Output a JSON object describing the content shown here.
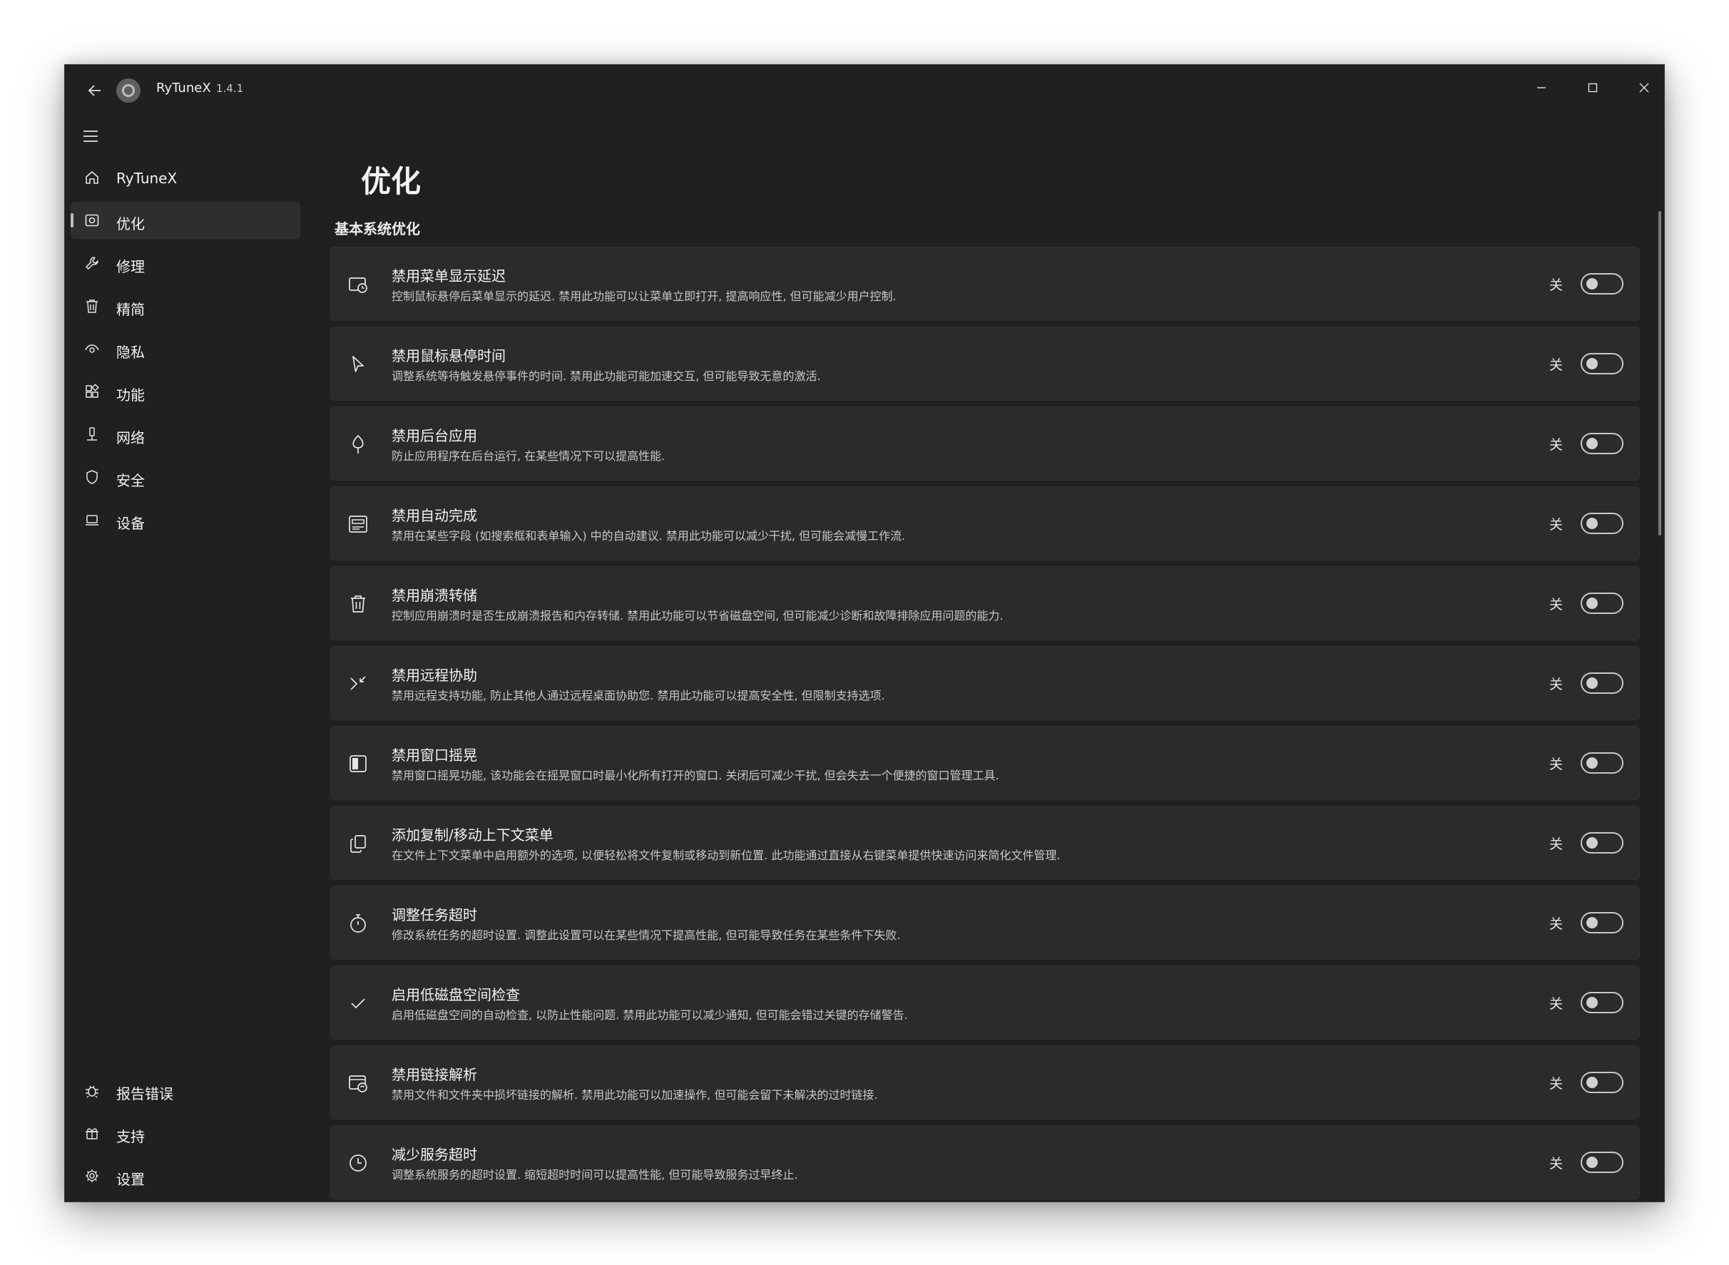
{
  "app": {
    "title": "RyTuneX",
    "version": "1.4.1"
  },
  "sidebar": {
    "items": [
      {
        "label": "RyTuneX",
        "icon": "home-icon"
      },
      {
        "label": "优化",
        "icon": "optimize-icon",
        "selected": true
      },
      {
        "label": "修理",
        "icon": "wrench-icon"
      },
      {
        "label": "精简",
        "icon": "trash-icon"
      },
      {
        "label": "隐私",
        "icon": "eye-icon"
      },
      {
        "label": "功能",
        "icon": "apps-icon"
      },
      {
        "label": "网络",
        "icon": "network-icon"
      },
      {
        "label": "安全",
        "icon": "shield-icon"
      },
      {
        "label": "设备",
        "icon": "laptop-icon"
      }
    ],
    "footer": [
      {
        "label": "报告错误",
        "icon": "bug-icon"
      },
      {
        "label": "支持",
        "icon": "support-icon"
      },
      {
        "label": "设置",
        "icon": "gear-icon"
      }
    ]
  },
  "page": {
    "title": "优化",
    "section": "基本系统优化",
    "toggle_off_label": "关"
  },
  "settings": [
    {
      "title": "禁用菜单显示延迟",
      "desc": "控制鼠标悬停后菜单显示的延迟. 禁用此功能可以让菜单立即打开, 提高响应性, 但可能减少用户控制.",
      "state": "off",
      "icon": "menu-delay-icon"
    },
    {
      "title": "禁用鼠标悬停时间",
      "desc": "调整系统等待触发悬停事件的时间. 禁用此功能可能加速交互, 但可能导致无意的激活.",
      "state": "off",
      "icon": "cursor-icon"
    },
    {
      "title": "禁用后台应用",
      "desc": "防止应用程序在后台运行, 在某些情况下可以提高性能.",
      "state": "off",
      "icon": "leaf-icon"
    },
    {
      "title": "禁用自动完成",
      "desc": "禁用在某些字段 (如搜索框和表单输入) 中的自动建议. 禁用此功能可以减少干扰, 但可能会减慢工作流.",
      "state": "off",
      "icon": "form-icon"
    },
    {
      "title": "禁用崩溃转储",
      "desc": "控制应用崩溃时是否生成崩溃报告和内存转储. 禁用此功能可以节省磁盘空间, 但可能减少诊断和故障排除应用问题的能力.",
      "state": "off",
      "icon": "delete-icon"
    },
    {
      "title": "禁用远程协助",
      "desc": "禁用远程支持功能, 防止其他人通过远程桌面协助您. 禁用此功能可以提高安全性, 但限制支持选项.",
      "state": "off",
      "icon": "remote-icon"
    },
    {
      "title": "禁用窗口摇晃",
      "desc": "禁用窗口摇晃功能, 该功能会在摇晃窗口时最小化所有打开的窗口. 关闭后可减少干扰, 但会失去一个便捷的窗口管理工具.",
      "state": "off",
      "icon": "window-icon"
    },
    {
      "title": "添加复制/移动上下文菜单",
      "desc": "在文件上下文菜单中启用额外的选项, 以便轻松将文件复制或移动到新位置. 此功能通过直接从右键菜单提供快速访问来简化文件管理.",
      "state": "off",
      "icon": "copy-icon"
    },
    {
      "title": "调整任务超时",
      "desc": "修改系统任务的超时设置. 调整此设置可以在某些情况下提高性能, 但可能导致任务在某些条件下失败.",
      "state": "off",
      "icon": "stopwatch-icon"
    },
    {
      "title": "启用低磁盘空间检查",
      "desc": "启用低磁盘空间的自动检查, 以防止性能问题. 禁用此功能可以减少通知, 但可能会错过关键的存储警告.",
      "state": "off",
      "icon": "checkmark-icon"
    },
    {
      "title": "禁用链接解析",
      "desc": "禁用文件和文件夹中损坏链接的解析. 禁用此功能可以加速操作, 但可能会留下未解决的过时链接.",
      "state": "off",
      "icon": "link-resolve-icon"
    },
    {
      "title": "减少服务超时",
      "desc": "调整系统服务的超时设置. 缩短超时时间可以提高性能, 但可能导致服务过早终止.",
      "state": "off",
      "icon": "clock-icon"
    }
  ]
}
